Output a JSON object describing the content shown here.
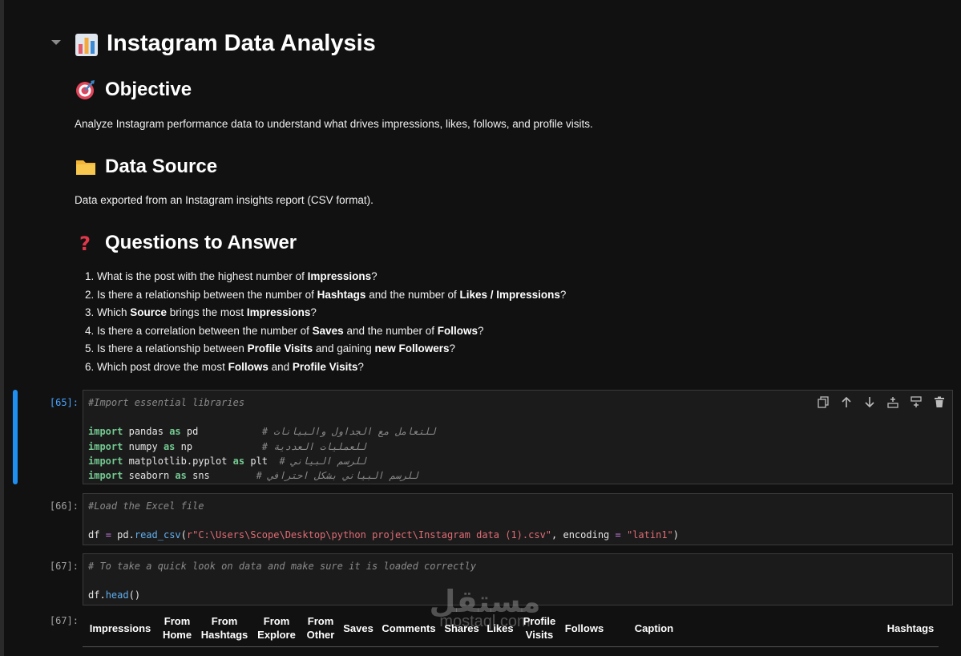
{
  "notebook": {
    "title": "Instagram Data Analysis",
    "sections": {
      "objective": {
        "heading": "Objective",
        "text": "Analyze Instagram performance data to understand what drives impressions, likes, follows, and profile visits."
      },
      "data_source": {
        "heading": "Data Source",
        "text": "Data exported from an Instagram insights report (CSV format)."
      },
      "questions": {
        "heading": "Questions to Answer",
        "items": [
          {
            "a": "What is the post with the highest number of ",
            "b": "Impressions",
            "c": "?"
          },
          {
            "a": "Is there a relationship between the number of ",
            "b": "Hashtags",
            "c": " and the number of ",
            "d": "Likes / Impressions",
            "e": "?"
          },
          {
            "a": "Which ",
            "b": "Source",
            "c": " brings the most ",
            "d": "Impressions",
            "e": "?"
          },
          {
            "a": "Is there a correlation between the number of ",
            "b": "Saves",
            "c": " and the number of ",
            "d": "Follows",
            "e": "?"
          },
          {
            "a": "Is there a relationship between ",
            "b": "Profile Visits",
            "c": " and gaining ",
            "d": "new Followers",
            "e": "?"
          },
          {
            "a": "Which post drove the most ",
            "b": "Follows",
            "c": " and ",
            "d": "Profile Visits",
            "e": "?"
          }
        ]
      }
    },
    "cells": [
      {
        "prompt": "[65]:",
        "comment": "#Import essential libraries",
        "imports": [
          {
            "kw": "import",
            "mod": "pandas",
            "as": "as",
            "alias": "pd",
            "note": "# للتعامل مع الجداول والبيانات"
          },
          {
            "kw": "import",
            "mod": "numpy",
            "as": "as",
            "alias": "np",
            "note": "# للعمليات العددية"
          },
          {
            "kw": "import",
            "mod": "matplotlib.pyplot",
            "as": "as",
            "alias": "plt",
            "note": "# للرسم البياني"
          },
          {
            "kw": "import",
            "mod": "seaborn",
            "as": "as",
            "alias": "sns",
            "note": "# للرسم البياني بشكل احترافي"
          }
        ]
      },
      {
        "prompt": "[66]:",
        "comment": "#Load the Excel file",
        "code": {
          "var": "df",
          "eq": "=",
          "obj": "pd.",
          "fn": "read_csv",
          "open": "(",
          "path": "r\"C:\\Users\\Scope\\Desktop\\python project\\Instagram data (1).csv\"",
          "sep": ", encoding ",
          "eq2": "=",
          "enc": "\"latin1\"",
          "close": ")"
        }
      },
      {
        "prompt": "[67]:",
        "comment": "# To take a quick look on data and make sure it is loaded correctly",
        "code": {
          "obj": "df.",
          "fn": "head",
          "call": "()"
        }
      }
    ],
    "output": {
      "prompt": "[67]:",
      "columns": [
        "Impressions",
        "From Home",
        "From Hashtags",
        "From Explore",
        "From Other",
        "Saves",
        "Comments",
        "Shares",
        "Likes",
        "Profile Visits",
        "Follows",
        "Caption",
        "Hashtags"
      ]
    },
    "watermark": {
      "ar": "مستقل",
      "en": "mostaql.com"
    }
  }
}
